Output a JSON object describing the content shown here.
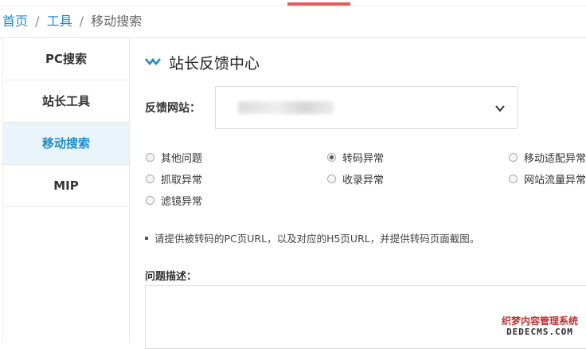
{
  "breadcrumb": {
    "home": "首页",
    "tools": "工具",
    "current": "移动搜索",
    "separator": "/"
  },
  "sidebar": {
    "items": [
      {
        "label": "PC搜索",
        "active": false
      },
      {
        "label": "站长工具",
        "active": false
      },
      {
        "label": "移动搜索",
        "active": true
      },
      {
        "label": "MIP",
        "active": false
      }
    ]
  },
  "main": {
    "title": "站长反馈中心",
    "site_label": "反馈网站：",
    "site_value": "",
    "issues": [
      {
        "label": "其他问题",
        "checked": false
      },
      {
        "label": "转码异常",
        "checked": true
      },
      {
        "label": "移动适配异常",
        "checked": false
      },
      {
        "label": "抓取异常",
        "checked": false
      },
      {
        "label": "收录异常",
        "checked": false
      },
      {
        "label": "网站流量异常",
        "checked": false
      },
      {
        "label": "滤镜异常",
        "checked": false
      }
    ],
    "hint": "请提供被转码的PC页URL，以及对应的H5页URL，并提供转码页面截图。",
    "desc_label": "问题描述："
  },
  "watermark": {
    "line1": "织梦内容管理系统",
    "line2": "DEDECMS.COM"
  },
  "colors": {
    "accent": "#1f8cc9",
    "top_bar": "#e85b5b",
    "active_bg": "#e9f4fb"
  }
}
